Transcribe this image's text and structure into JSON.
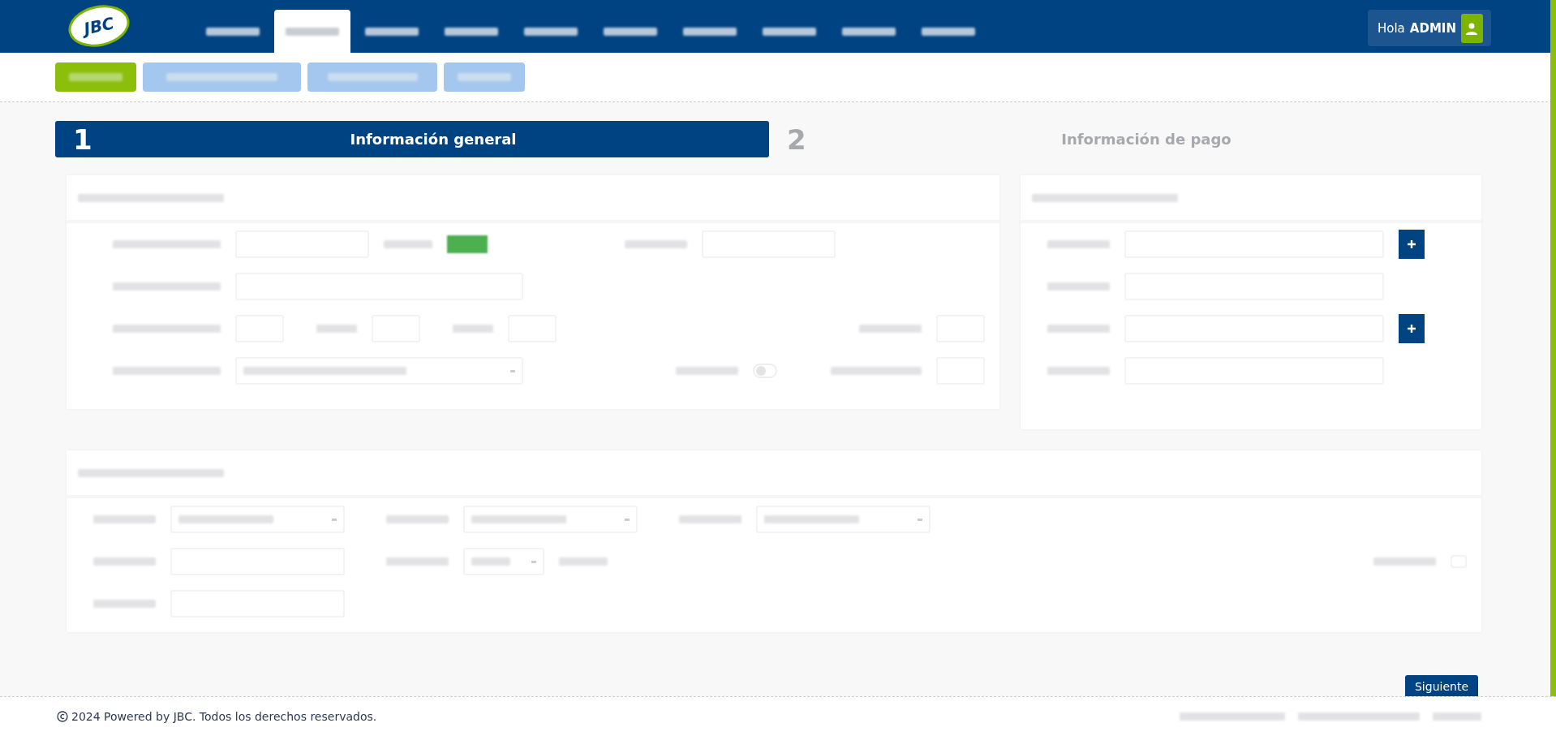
{
  "header": {
    "logo": "JBC",
    "nav": [
      {
        "selected": false
      },
      {
        "selected": true
      },
      {
        "selected": false
      },
      {
        "selected": false
      },
      {
        "selected": false
      },
      {
        "selected": false
      },
      {
        "selected": false
      },
      {
        "selected": false
      },
      {
        "selected": false
      },
      {
        "selected": false
      }
    ],
    "greeting": "Hola",
    "user": "ADMIN"
  },
  "subnav": [
    {
      "kind": "primary"
    },
    {
      "kind": "secondary"
    },
    {
      "kind": "secondary"
    },
    {
      "kind": "secondary"
    }
  ],
  "steps": [
    {
      "number": "1",
      "title": "Información general",
      "selected": true
    },
    {
      "number": "2",
      "title": "Información de pago",
      "selected": false
    }
  ],
  "contract": {
    "toggle_on": false
  },
  "vehicle": {
    "checkbox_checked": false
  },
  "next_button": "Siguiente",
  "footer": {
    "copyright": "2024 Powered by JBC. Todos los derechos reservados."
  }
}
